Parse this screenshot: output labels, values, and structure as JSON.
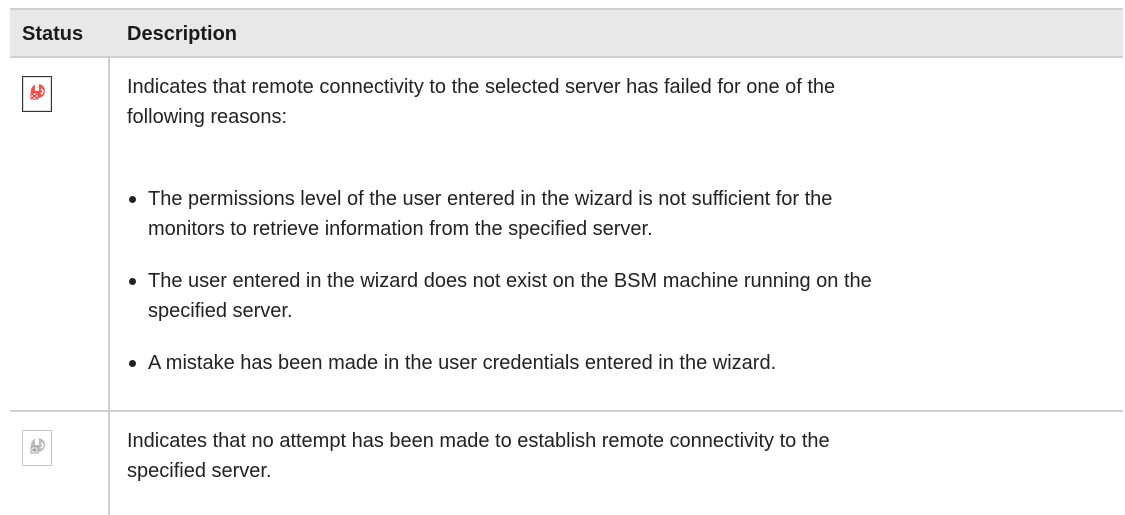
{
  "table": {
    "headers": {
      "status": "Status",
      "description": "Description"
    },
    "rows": [
      {
        "icon": "connectivity-failed-icon",
        "icon_color": "#e53935",
        "description_lines": [
          "Indicates that remote connectivity to the selected server has failed for one of the",
          "following reasons:"
        ],
        "bullets": [
          {
            "lines": [
              "The permissions level of the user entered in the wizard is not sufficient for the",
              "monitors to retrieve information from the specified server."
            ]
          },
          {
            "lines": [
              "The user entered in the wizard does not exist on the BSM machine running on the",
              "specified server."
            ]
          },
          {
            "lines": [
              "A mistake has been made in the user credentials entered in the wizard."
            ]
          }
        ]
      },
      {
        "icon": "connectivity-not-attempted-icon",
        "icon_color": "#9e9e9e",
        "description_lines": [
          "Indicates that no attempt has been made to establish remote connectivity to the",
          "specified server."
        ]
      }
    ]
  }
}
